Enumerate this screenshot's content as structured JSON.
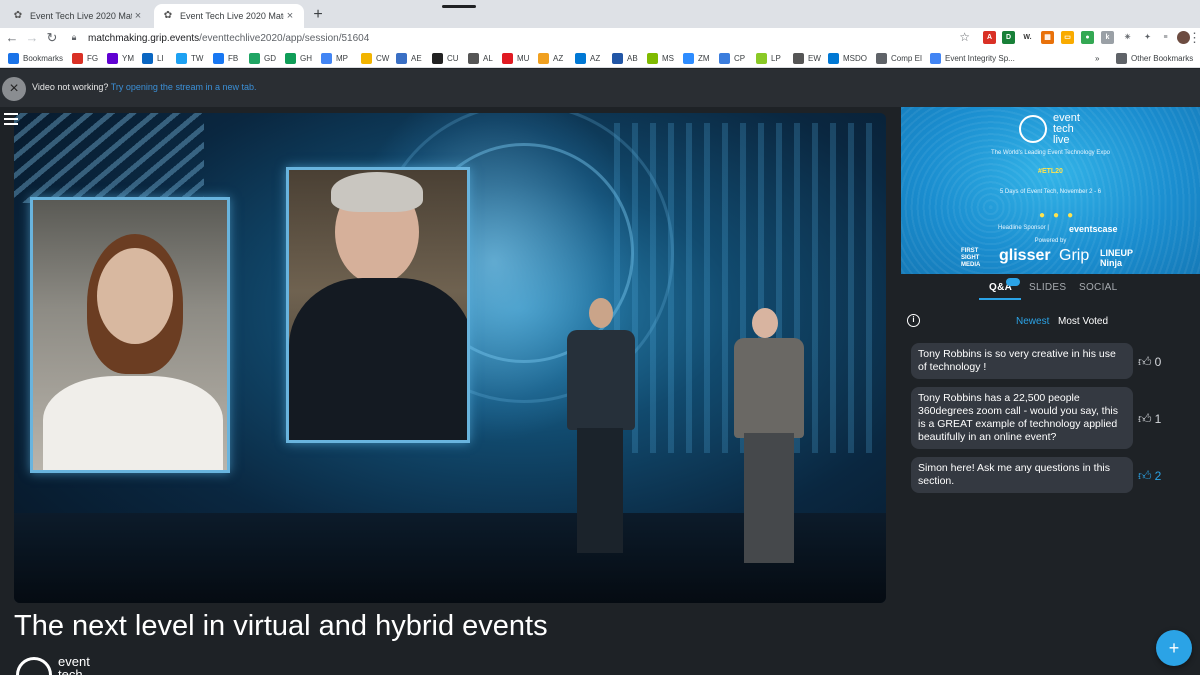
{
  "browser": {
    "tabs": [
      {
        "title": "Event Tech Live 2020 Matchm",
        "icon": "paw-icon"
      },
      {
        "title": "Event Tech Live 2020 Matc",
        "icon": "paw-icon"
      }
    ],
    "new_tab": "+",
    "url_host": "matchmaking.grip.events",
    "url_path": "/eventtechlive2020/app/session/51604",
    "bookmarks": [
      {
        "label": "Bookmarks",
        "icon": "star-icon",
        "color": "#1a73e8"
      },
      {
        "label": "FG",
        "icon": "gmail-icon",
        "color": "#d93025"
      },
      {
        "label": "YM",
        "icon": "mail-icon",
        "color": "#6001d2"
      },
      {
        "label": "LI",
        "icon": "linkedin-icon",
        "color": "#0a66c2"
      },
      {
        "label": "TW",
        "icon": "twitter-icon",
        "color": "#1da1f2"
      },
      {
        "label": "FB",
        "icon": "facebook-icon",
        "color": "#1877f2"
      },
      {
        "label": "GD",
        "icon": "drive-icon",
        "color": "#1fa463"
      },
      {
        "label": "GH",
        "icon": "hangouts-icon",
        "color": "#0f9d58"
      },
      {
        "label": "MP",
        "icon": "google-icon",
        "color": "#4285f4"
      },
      {
        "label": "CW",
        "icon": "cw-icon",
        "color": "#f2b400"
      },
      {
        "label": "AE",
        "icon": "ae-icon",
        "color": "#3a6fc4"
      },
      {
        "label": "CU",
        "icon": "cu-icon",
        "color": "#222222"
      },
      {
        "label": "AL",
        "icon": "al-icon",
        "color": "#555555"
      },
      {
        "label": "MU",
        "icon": "mu-icon",
        "color": "#e01a22"
      },
      {
        "label": "AZ",
        "icon": "amazon-icon",
        "color": "#f0a020"
      },
      {
        "label": "AZ",
        "icon": "azure-icon",
        "color": "#0078d4"
      },
      {
        "label": "AB",
        "icon": "ab-icon",
        "color": "#2256a6"
      },
      {
        "label": "MS",
        "icon": "microsoft-icon",
        "color": "#7fba00"
      },
      {
        "label": "ZM",
        "icon": "zoom-icon",
        "color": "#2d8cff"
      },
      {
        "label": "CP",
        "icon": "cp-icon",
        "color": "#3b7ddd"
      },
      {
        "label": "LP",
        "icon": "lp-icon",
        "color": "#8ac926"
      },
      {
        "label": "EW",
        "icon": "ew-icon",
        "color": "#555555"
      },
      {
        "label": "MSDO",
        "icon": "msdo-icon",
        "color": "#0078d4"
      },
      {
        "label": "Comp EI",
        "icon": "folder-icon",
        "color": "#5f6368"
      },
      {
        "label": "Event Integrity Sp...",
        "icon": "doc-icon",
        "color": "#4285f4"
      }
    ],
    "bookmarks_more": "»",
    "other_bookmarks": "Other Bookmarks"
  },
  "banner": {
    "message": "Video not working?",
    "link": "Try opening the stream in a new tab."
  },
  "session": {
    "title": "The next level in virtual and hybrid events",
    "logo_line1": "event",
    "logo_line2": "tech"
  },
  "sponsor": {
    "logo_line1": "event",
    "logo_line2": "tech",
    "logo_line3": "live",
    "tagline": "The World's Leading Event Technology Expo",
    "hashtag": "#ETL20",
    "dates": "5 Days of Event Tech, November 2 - 6",
    "headline_sponsor": "Headline Sponsor |",
    "headline_sponsor_name": "eventscase",
    "powered_by": "Powered by",
    "brands": [
      "FIRST SIGHT MEDIA",
      "glisser",
      "Grip",
      "LINEUP Ninja"
    ]
  },
  "panel": {
    "tabs": [
      "Q&A",
      "SLIDES",
      "SOCIAL"
    ],
    "filters": {
      "newest": "Newest",
      "most_voted": "Most Voted"
    },
    "questions": [
      {
        "text": "Tony Robbins is so very creative in his use of technology !",
        "votes": "0",
        "voted": false
      },
      {
        "text": "Tony Robbins has a 22,500 people 360degrees zoom call - would you say, this is a GREAT example of technology applied beautifully in an online event?",
        "votes": "1",
        "voted": false
      },
      {
        "text": "Simon here! Ask me any questions in this section.",
        "votes": "2",
        "voted": true
      }
    ],
    "fab": "+",
    "accent": "#2ba3e6"
  }
}
